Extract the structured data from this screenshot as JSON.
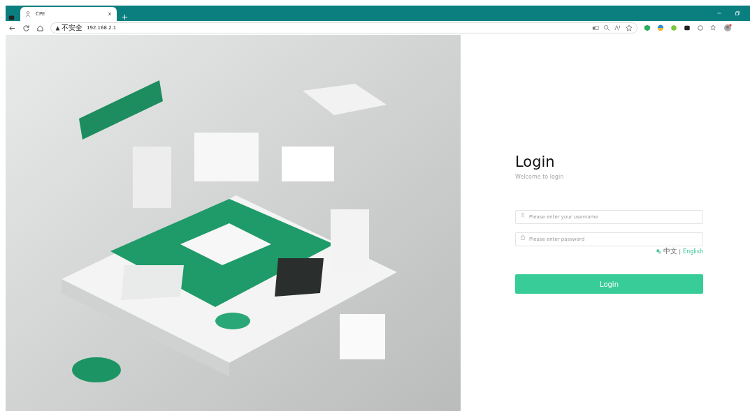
{
  "browser": {
    "tabs": [
      {
        "title": "CPE",
        "selected": true
      }
    ],
    "address_bar": {
      "security_label": "不安全",
      "url": "192.168.2.1"
    }
  },
  "login": {
    "title": "Login",
    "subtitle": "Welcome to login",
    "username": {
      "placeholder": "Please enter your username"
    },
    "password": {
      "placeholder": "Please enter password"
    },
    "languages": [
      {
        "label": "中文",
        "selected": false
      },
      {
        "label": "English",
        "selected": true
      }
    ],
    "separator": "|",
    "button": "Login"
  }
}
